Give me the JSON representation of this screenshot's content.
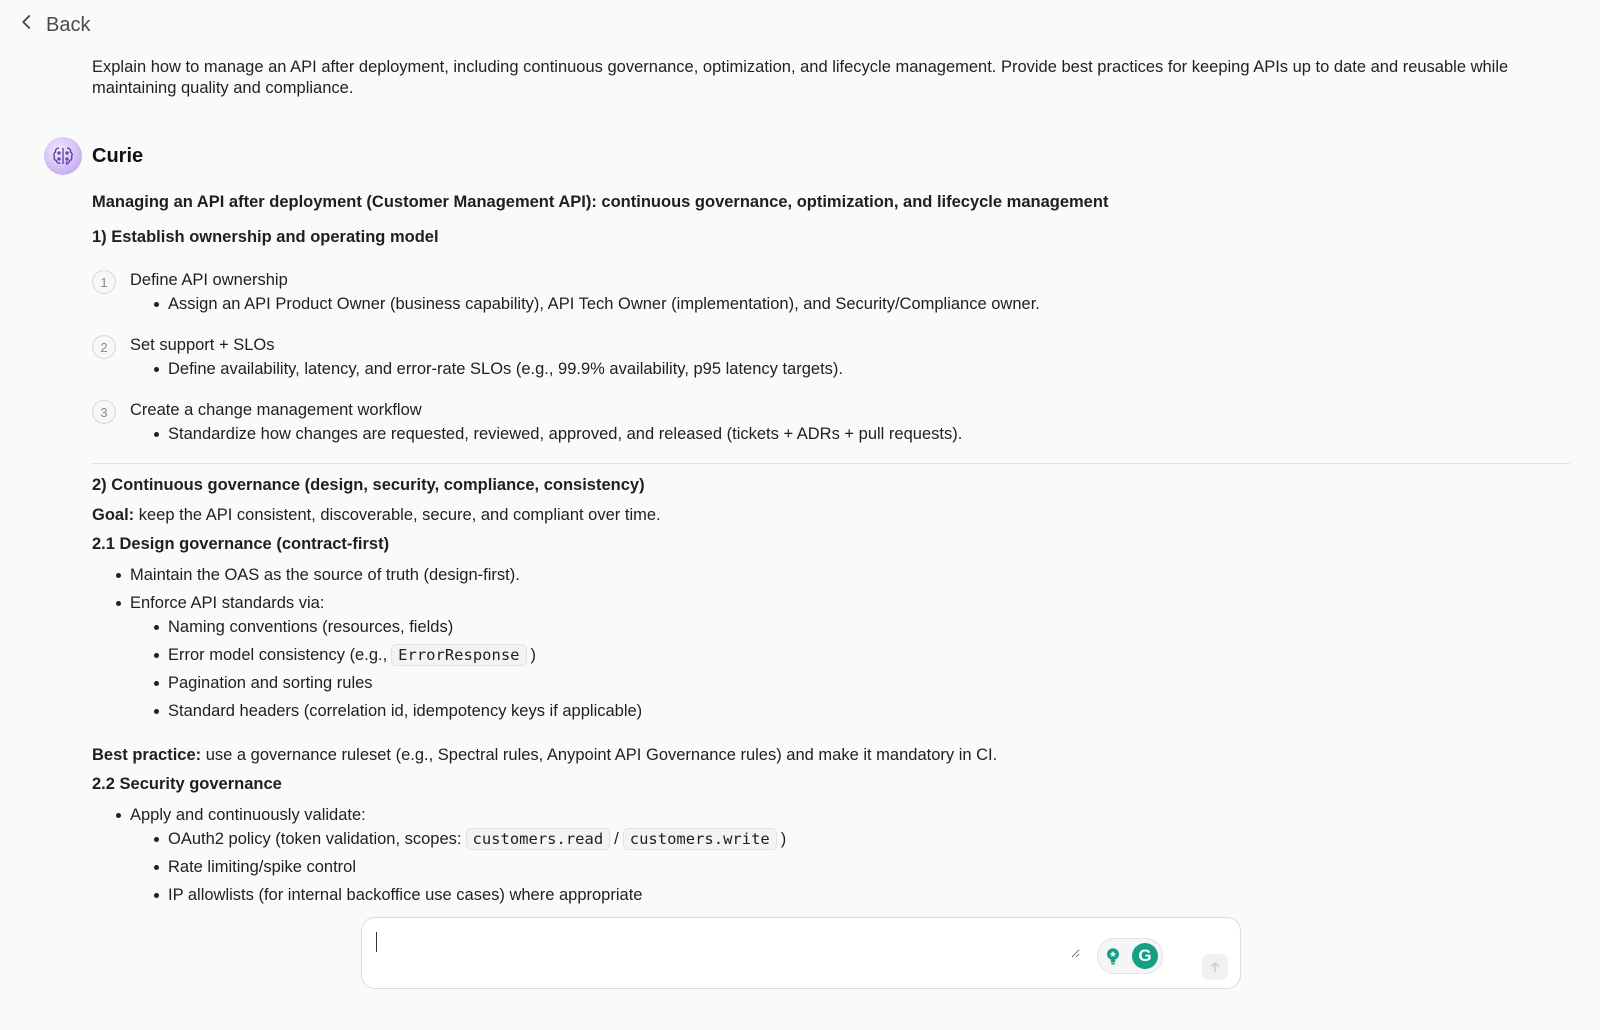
{
  "nav": {
    "back_label": "Back"
  },
  "user_message": "Explain how to manage an API after deployment, including continuous governance, optimization, and lifecycle management. Provide best practices for keeping APIs up to date and reusable while maintaining quality and compliance.",
  "assistant": {
    "name": "Curie",
    "title": "Managing an API after deployment (Customer Management API): continuous governance, optimization, and lifecycle management",
    "section1": {
      "heading": "1) Establish ownership and operating model",
      "steps": [
        {
          "num": "1",
          "title": "Define API ownership",
          "bullet": "Assign an API Product Owner (business capability), API Tech Owner (implementation), and Security/Compliance owner."
        },
        {
          "num": "2",
          "title": "Set support + SLOs",
          "bullet": "Define availability, latency, and error-rate SLOs (e.g., 99.9% availability, p95 latency targets)."
        },
        {
          "num": "3",
          "title": "Create a change management workflow",
          "bullet": "Standardize how changes are requested, reviewed, approved, and released (tickets + ADRs + pull requests)."
        }
      ]
    },
    "section2": {
      "heading": "2) Continuous governance (design, security, compliance, consistency)",
      "goal_label": "Goal:",
      "goal_text": " keep the API consistent, discoverable, secure, and compliant over time.",
      "sub1": {
        "heading": "2.1 Design governance (contract-first)",
        "b1_pre": "Maintain the OAS as the ",
        "b1_strong": "source of truth",
        "b1_post": " (design-first).",
        "b2": "Enforce API standards via:",
        "sub_bullets": {
          "naming": "Naming conventions (resources, fields)",
          "error_pre": "Error model consistency (e.g.,",
          "error_code": "ErrorResponse",
          "error_post": ")",
          "pagination": "Pagination and sorting rules",
          "headers": "Standard headers (correlation id, idempotency keys if applicable)"
        }
      },
      "best_practice_label": "Best practice:",
      "best_practice_text": " use a governance ruleset (e.g., Spectral rules, Anypoint API Governance rules) and make it mandatory in CI.",
      "sub2": {
        "heading": "2.2 Security governance",
        "b1": "Apply and continuously validate:",
        "oauth_pre": "OAuth2 policy (token validation, scopes:",
        "scope_read": "customers.read",
        "scope_sep": "/",
        "scope_write": "customers.write",
        "oauth_post": ")",
        "rate": "Rate limiting/spike control",
        "ip": "IP allowlists (for internal backoffice use cases) where appropriate"
      }
    }
  },
  "composer": {
    "placeholder": ""
  },
  "icons": {
    "back": "chevron-left-icon",
    "avatar": "brain-icon",
    "ext1": "lightbulb-icon",
    "ext2": "grammarly-icon",
    "send": "arrow-up-icon"
  }
}
